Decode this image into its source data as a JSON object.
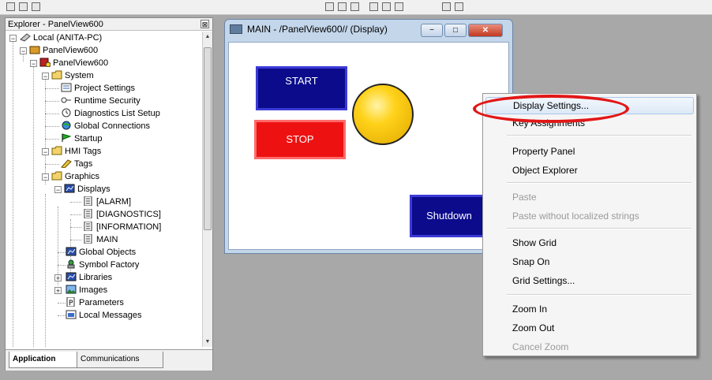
{
  "explorer": {
    "title": "Explorer - PanelView600",
    "close_glyph": "⊠",
    "tree": [
      {
        "label": "Local (ANITA-PC)",
        "icon": "network-icon"
      },
      {
        "label": "PanelView600",
        "icon": "project-icon"
      },
      {
        "label": "PanelView600",
        "icon": "terminal-icon"
      },
      {
        "label": "System",
        "icon": "folder-icon"
      },
      {
        "label": "Project Settings",
        "icon": "settings-doc-icon"
      },
      {
        "label": "Runtime Security",
        "icon": "key-icon"
      },
      {
        "label": "Diagnostics List Setup",
        "icon": "clock-icon"
      },
      {
        "label": "Global Connections",
        "icon": "globe-icon"
      },
      {
        "label": "Startup",
        "icon": "flag-icon"
      },
      {
        "label": "HMI Tags",
        "icon": "folder-icon"
      },
      {
        "label": "Tags",
        "icon": "tag-icon"
      },
      {
        "label": "Graphics",
        "icon": "folder-icon"
      },
      {
        "label": "Displays",
        "icon": "displays-icon"
      },
      {
        "label": "[ALARM]",
        "icon": "document-icon"
      },
      {
        "label": "[DIAGNOSTICS]",
        "icon": "document-icon"
      },
      {
        "label": "[INFORMATION]",
        "icon": "document-icon"
      },
      {
        "label": "MAIN",
        "icon": "document-icon"
      },
      {
        "label": "Global Objects",
        "icon": "global-objects-icon"
      },
      {
        "label": "Symbol Factory",
        "icon": "symbol-factory-icon"
      },
      {
        "label": "Libraries",
        "icon": "libraries-icon"
      },
      {
        "label": "Images",
        "icon": "images-icon"
      },
      {
        "label": "Parameters",
        "icon": "parameters-icon"
      },
      {
        "label": "Local Messages",
        "icon": "messages-icon"
      }
    ],
    "tabs": {
      "application": "Application",
      "communications": "Communications"
    }
  },
  "display_window": {
    "title": "MAIN - /PanelView600// (Display)",
    "buttons": {
      "start": "START",
      "stop": "STOP",
      "shutdown": "Shutdown"
    }
  },
  "context_menu": {
    "items": [
      {
        "label": "Display Settings...",
        "enabled": true
      },
      {
        "label": "Key Assignments",
        "enabled": true
      },
      {
        "label": "Property Panel",
        "enabled": true
      },
      {
        "label": "Object Explorer",
        "enabled": true
      },
      {
        "label": "Paste",
        "enabled": false
      },
      {
        "label": "Paste without localized strings",
        "enabled": false
      },
      {
        "label": "Show Grid",
        "enabled": true
      },
      {
        "label": "Snap On",
        "enabled": true
      },
      {
        "label": "Grid Settings...",
        "enabled": true
      },
      {
        "label": "Zoom In",
        "enabled": true
      },
      {
        "label": "Zoom Out",
        "enabled": true
      },
      {
        "label": "Cancel Zoom",
        "enabled": false
      }
    ]
  },
  "colors": {
    "highlight_oval": "#e21717",
    "start_button": "#0b0b8c",
    "stop_button": "#ee1111",
    "lamp": "#ffd21a"
  }
}
